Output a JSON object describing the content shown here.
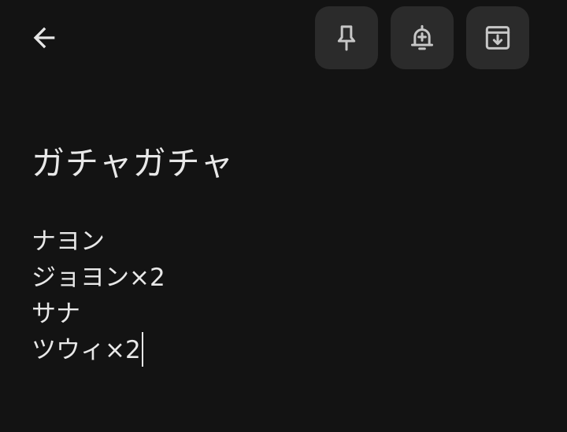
{
  "toolbar": {
    "back_icon": "arrow-left-icon",
    "actions": [
      {
        "name": "pin",
        "icon": "pin-icon"
      },
      {
        "name": "reminder",
        "icon": "bell-plus-icon"
      },
      {
        "name": "archive",
        "icon": "archive-icon"
      }
    ]
  },
  "note": {
    "title": "ガチャガチャ",
    "lines": [
      "ナヨン",
      "ジョヨン×2",
      "サナ",
      "ツウィ×2"
    ]
  },
  "colors": {
    "background": "#131313",
    "button_bg": "#2b2b2b",
    "text": "#e8e8e8",
    "icon": "#c7c7c7"
  }
}
